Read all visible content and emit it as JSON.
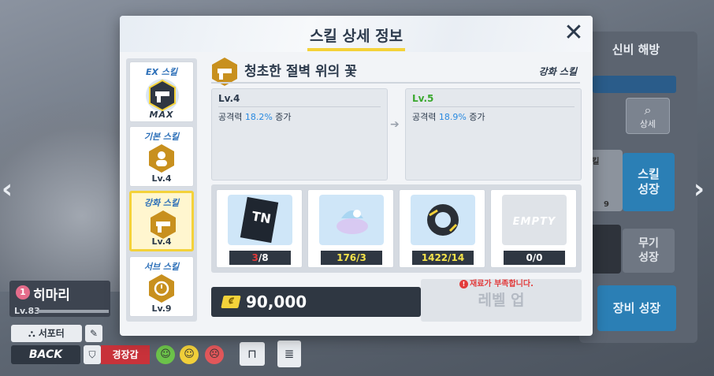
{
  "background": {
    "top_right_tab": "신비 해방",
    "detail_label": "상세",
    "skill_grow_label_1": "스킬",
    "skill_grow_label_2": "성장",
    "weapon_grow_label_1": "무기",
    "weapon_grow_label_2": "성장",
    "equip_grow_label": "장비 성장",
    "slot_label": "스킬",
    "slot_lv": "9",
    "character": {
      "bond_level": "1",
      "name": "히마리",
      "level": "Lv.83",
      "role": "서포터"
    },
    "back_label": "BACK",
    "alert_label": "경장갑"
  },
  "modal": {
    "title": "스킬 상세 정보",
    "close_icon": "close-icon",
    "tabs": [
      {
        "label": "EX 스킬",
        "level": "MAX",
        "icon": "gun-icon"
      },
      {
        "label": "기본 스킬",
        "level": "Lv.4",
        "icon": "person-icon"
      },
      {
        "label": "강화 스킬",
        "level": "Lv.4",
        "icon": "gun-icon"
      },
      {
        "label": "서브 스킬",
        "level": "Lv.9",
        "icon": "cost-icon"
      }
    ],
    "skill": {
      "name": "청초한 절벽 위의 꽃",
      "type": "강화 스킬"
    },
    "current": {
      "level": "Lv.4",
      "desc_prefix": "공격력 ",
      "desc_value": "18.2%",
      "desc_suffix": " 증가"
    },
    "next": {
      "level": "Lv.5",
      "desc_prefix": "공격력 ",
      "desc_value": "18.9%",
      "desc_suffix": " 증가"
    },
    "materials": [
      {
        "owned": "3",
        "required": "/8",
        "sufficient": false
      },
      {
        "count": "176/3",
        "sufficient": true
      },
      {
        "count": "1422/14",
        "sufficient": true
      },
      {
        "label": "EMPTY",
        "count": "0/0",
        "sufficient": false
      }
    ],
    "cost": "90,000",
    "warning": "재료가 부족합니다.",
    "levelup_label": "레벨 업"
  },
  "colors": {
    "accent_yellow": "#f4d23a",
    "dark_panel": "#2f3742",
    "highlight_blue": "#2a8ae0",
    "next_green": "#3aa82e",
    "error_red": "#e23b3b"
  }
}
